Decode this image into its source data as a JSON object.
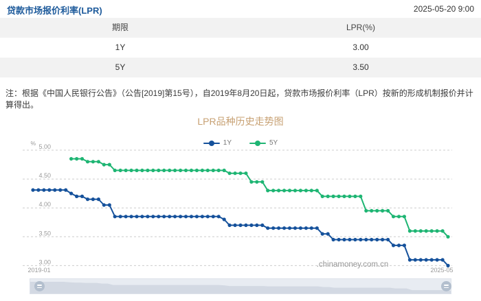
{
  "header": {
    "title": "贷款市场报价利率(LPR)",
    "timestamp": "2025-05-20 9:00"
  },
  "table": {
    "columns": [
      "期限",
      "LPR(%)"
    ],
    "rows": [
      {
        "term": "1Y",
        "rate": "3.00"
      },
      {
        "term": "5Y",
        "rate": "3.50"
      }
    ]
  },
  "note": "注：根据《中国人民银行公告》（公告[2019]第15号），自2019年8月20日起，贷款市场报价利率（LPR）按新的形成机制报价并计算得出。",
  "watermark": ".chinamoney.com.cn",
  "colors": {
    "title_blue": "#1d5a9b",
    "chart_title_tan": "#c7a072",
    "series_1y": "#15519b",
    "series_5y": "#1eb573",
    "gridline": "#cccccc",
    "axis_text": "#999999",
    "slider_bg": "#e8ecf2",
    "slider_shadow": "#d3d9e3",
    "slider_handle": "#b3bfce"
  },
  "chart_data": {
    "type": "line",
    "title": "LPR品种历史走势图",
    "ylabel": "%",
    "ylim": [
      3.0,
      5.0
    ],
    "yticks": [
      5.0,
      4.5,
      4.0,
      3.5,
      3.0
    ],
    "xticks": [
      "2019-01",
      "2025-05"
    ],
    "x_unit": "month",
    "x_start": "2019-01",
    "x_end": "2025-05",
    "grid": "dashed-horizontal",
    "legend_position": "top",
    "series": [
      {
        "name": "1Y",
        "color": "#15519b",
        "values": [
          4.31,
          4.31,
          4.31,
          4.31,
          4.31,
          4.31,
          4.31,
          4.25,
          4.2,
          4.2,
          4.15,
          4.15,
          4.15,
          4.05,
          4.05,
          3.85,
          3.85,
          3.85,
          3.85,
          3.85,
          3.85,
          3.85,
          3.85,
          3.85,
          3.85,
          3.85,
          3.85,
          3.85,
          3.85,
          3.85,
          3.85,
          3.85,
          3.85,
          3.85,
          3.85,
          3.8,
          3.7,
          3.7,
          3.7,
          3.7,
          3.7,
          3.7,
          3.7,
          3.65,
          3.65,
          3.65,
          3.65,
          3.65,
          3.65,
          3.65,
          3.65,
          3.65,
          3.65,
          3.55,
          3.55,
          3.45,
          3.45,
          3.45,
          3.45,
          3.45,
          3.45,
          3.45,
          3.45,
          3.45,
          3.45,
          3.45,
          3.35,
          3.35,
          3.35,
          3.1,
          3.1,
          3.1,
          3.1,
          3.1,
          3.1,
          3.1,
          3.0
        ]
      },
      {
        "name": "5Y",
        "color": "#1eb573",
        "values": [
          null,
          null,
          null,
          null,
          null,
          null,
          null,
          4.85,
          4.85,
          4.85,
          4.8,
          4.8,
          4.8,
          4.75,
          4.75,
          4.65,
          4.65,
          4.65,
          4.65,
          4.65,
          4.65,
          4.65,
          4.65,
          4.65,
          4.65,
          4.65,
          4.65,
          4.65,
          4.65,
          4.65,
          4.65,
          4.65,
          4.65,
          4.65,
          4.65,
          4.65,
          4.6,
          4.6,
          4.6,
          4.6,
          4.45,
          4.45,
          4.45,
          4.3,
          4.3,
          4.3,
          4.3,
          4.3,
          4.3,
          4.3,
          4.3,
          4.3,
          4.3,
          4.2,
          4.2,
          4.2,
          4.2,
          4.2,
          4.2,
          4.2,
          4.2,
          3.95,
          3.95,
          3.95,
          3.95,
          3.95,
          3.85,
          3.85,
          3.85,
          3.6,
          3.6,
          3.6,
          3.6,
          3.6,
          3.6,
          3.6,
          3.5
        ]
      }
    ]
  }
}
